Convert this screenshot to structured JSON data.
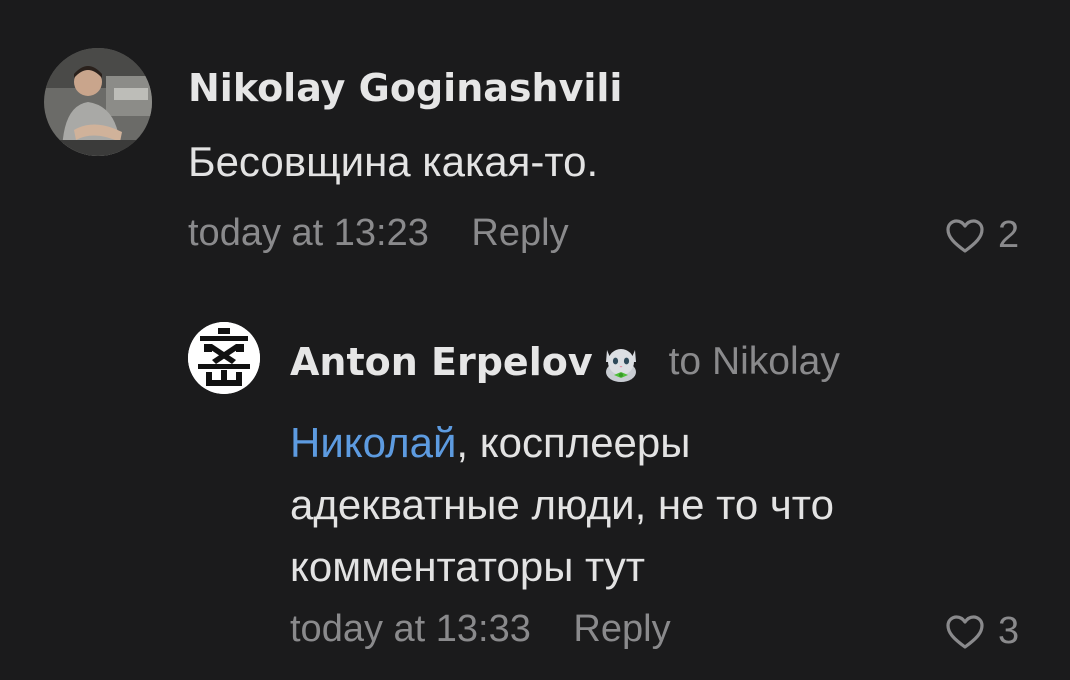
{
  "comments": [
    {
      "author": "Nikolay Goginashvili",
      "text": "Бесовщина какая-то.",
      "time": "today at 13:23",
      "reply_label": "Reply",
      "likes": "2"
    },
    {
      "author": "Anton Erpelov",
      "badge_icon": "cat-emoji-icon",
      "to_label": "to Nikolay",
      "mention": "Николай",
      "text_line1_rest": ", косплееры",
      "text_line2": "адекватные люди, не то что",
      "text_line3": "комментаторы тут",
      "time": "today at 13:33",
      "reply_label": "Reply",
      "likes": "3"
    }
  ],
  "colors": {
    "background": "#1b1b1c",
    "text": "#e3e3e3",
    "meta": "#8a8a8c",
    "mention": "#5d9be0"
  }
}
